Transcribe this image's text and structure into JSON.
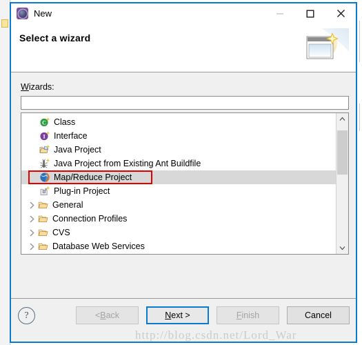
{
  "window": {
    "title": "New",
    "icon": "eclipse-cog-icon",
    "controls": {
      "minimize": "—",
      "maximize": "□",
      "close": "✕"
    },
    "accent_color": "#0a7ad1"
  },
  "header": {
    "title": "Select a wizard",
    "banner_icon": "new-wizard-sparkle-icon"
  },
  "form": {
    "wizards_label_prefix": "W",
    "wizards_label_rest": "izards:",
    "filter_value": "",
    "filter_placeholder": ""
  },
  "tree": {
    "items": [
      {
        "label": "Class",
        "icon": "java-class-icon",
        "type": "leaf",
        "expandable": false,
        "selected": false
      },
      {
        "label": "Interface",
        "icon": "java-interface-icon",
        "type": "leaf",
        "expandable": false,
        "selected": false
      },
      {
        "label": "Java Project",
        "icon": "java-project-icon",
        "type": "leaf",
        "expandable": false,
        "selected": false
      },
      {
        "label": "Java Project from Existing Ant Buildfile",
        "icon": "ant-buildfile-icon",
        "type": "leaf",
        "expandable": false,
        "selected": false
      },
      {
        "label": "Map/Reduce Project",
        "icon": "map-reduce-icon",
        "type": "leaf",
        "expandable": false,
        "selected": true
      },
      {
        "label": "Plug-in Project",
        "icon": "plugin-project-icon",
        "type": "leaf",
        "expandable": false,
        "selected": false
      },
      {
        "label": "General",
        "icon": "folder-icon",
        "type": "folder",
        "expandable": true,
        "selected": false
      },
      {
        "label": "Connection Profiles",
        "icon": "folder-icon",
        "type": "folder",
        "expandable": true,
        "selected": false
      },
      {
        "label": "CVS",
        "icon": "folder-icon",
        "type": "folder",
        "expandable": true,
        "selected": false
      },
      {
        "label": "Database Web Services",
        "icon": "folder-icon",
        "type": "folder",
        "expandable": true,
        "selected": false
      }
    ],
    "selection_highlight_color": "#e50000",
    "scrollbar": {
      "up_arrow": "˄",
      "down_arrow": "˅"
    }
  },
  "footer": {
    "help_label": "?",
    "buttons": [
      {
        "label": "< Back",
        "name": "back-button",
        "state": "disabled",
        "mnemonic": "B"
      },
      {
        "label": "Next >",
        "name": "next-button",
        "state": "default",
        "mnemonic": "N"
      },
      {
        "label": "Finish",
        "name": "finish-button",
        "state": "disabled",
        "mnemonic": "F"
      },
      {
        "label": "Cancel",
        "name": "cancel-button",
        "state": "enabled",
        "mnemonic": ""
      }
    ],
    "back_pre": "< ",
    "back_mn": "B",
    "back_post": "ack",
    "next_mn": "N",
    "next_post": "ext >",
    "finish_mn": "F",
    "finish_post": "inish",
    "cancel_text": "Cancel"
  },
  "watermark": {
    "text": "http://blog.csdn.net/Lord_War"
  }
}
